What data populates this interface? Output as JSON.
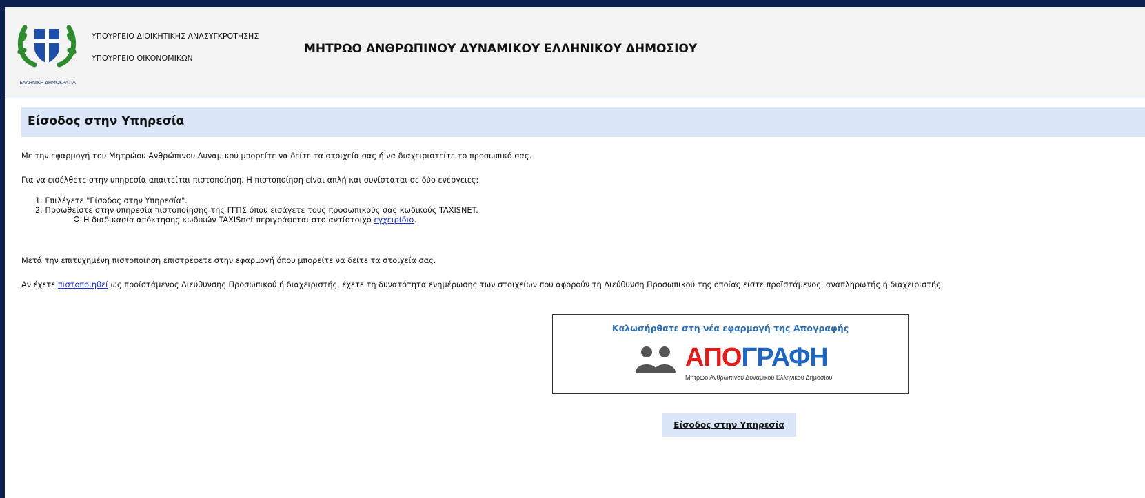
{
  "header": {
    "logo_caption": "ΕΛΛΗΝΙΚΗ ΔΗΜΟΚΡΑΤΙΑ",
    "ministry_1": "ΥΠΟΥΡΓΕΙΟ ΔΙΟΙΚΗΤΙΚΗΣ ΑΝΑΣΥΓΚΡΟΤΗΣΗΣ",
    "ministry_2": "ΥΠΟΥΡΓΕΙΟ ΟΙΚΟΝΟΜΙΚΩΝ",
    "registry_title": "ΜΗΤΡΩΟ ΑΝΘΡΩΠΙΝΟΥ ΔΥΝΑΜΙΚΟΥ ΕΛΛΗΝΙΚΟΥ ΔΗΜΟΣΙΟΥ"
  },
  "section": {
    "title": "Είσοδος στην Υπηρεσία"
  },
  "content": {
    "intro": "Με την εφαρμογή του Μητρώου Ανθρώπινου Δυναμικού μπορείτε να δείτε τα στοιχεία σας ή να διαχειριστείτε το προσωπικό σας.",
    "auth_intro": "Για να εισέλθετε στην υπηρεσία απαιτείται πιστοποίηση. Η πιστοποίηση είναι απλή και συνίσταται σε δύο ενέργειες:",
    "step_1": "1. Επιλέγετε \"Είσοδος στην Υπηρεσία\".",
    "step_2": "2. Προωθείστε στην υπηρεσία πιστοποίησης της ΓΓΠΣ όπου εισάγετε τους προσωπικούς σας κωδικούς TAXISNET.",
    "sub_text": "Η διαδικασία απόκτησης κωδικών TAXISnet περιγράφεται στο αντίστοιχο ",
    "sub_link": "εγχειρίδιο",
    "sub_end": ".",
    "after_auth": "Μετά την επιτυχημένη πιστοποίηση επιστρέφετε στην εφαρμογή όπου μπορείτε να δείτε τα στοιχεία σας.",
    "admin_pre": "Αν έχετε ",
    "admin_link": "πιστοποιηθεί",
    "admin_post": " ως προϊστάμενος Διεύθυνσης Προσωπικού ή διαχειριστής, έχετε τη δυνατότητα ενημέρωσης των στοιχείων που αφορούν τη Διεύθυνση Προσωπικού της οποίας είστε προϊστάμενος, αναπληρωτής ή διαχειριστής."
  },
  "banner": {
    "welcome": "Καλωσήρθατε στη νέα εφαρμογή της Απογραφής",
    "logo_title_red": "ΑΠΟ",
    "logo_title_blue": "ΓΡΑΦΗ",
    "logo_subtitle": "Μητρώο Ανθρώπινου Δυναμικού Ελληνικού Δημοσίου"
  },
  "login_button": "Είσοδος στην Υπηρεσία",
  "colors": {
    "accent_bar": "#dbe7f8",
    "link": "#1a2fd6",
    "logo_red": "#e21b1b",
    "logo_blue": "#1f66c1",
    "emblem_green": "#2e8b2e"
  }
}
